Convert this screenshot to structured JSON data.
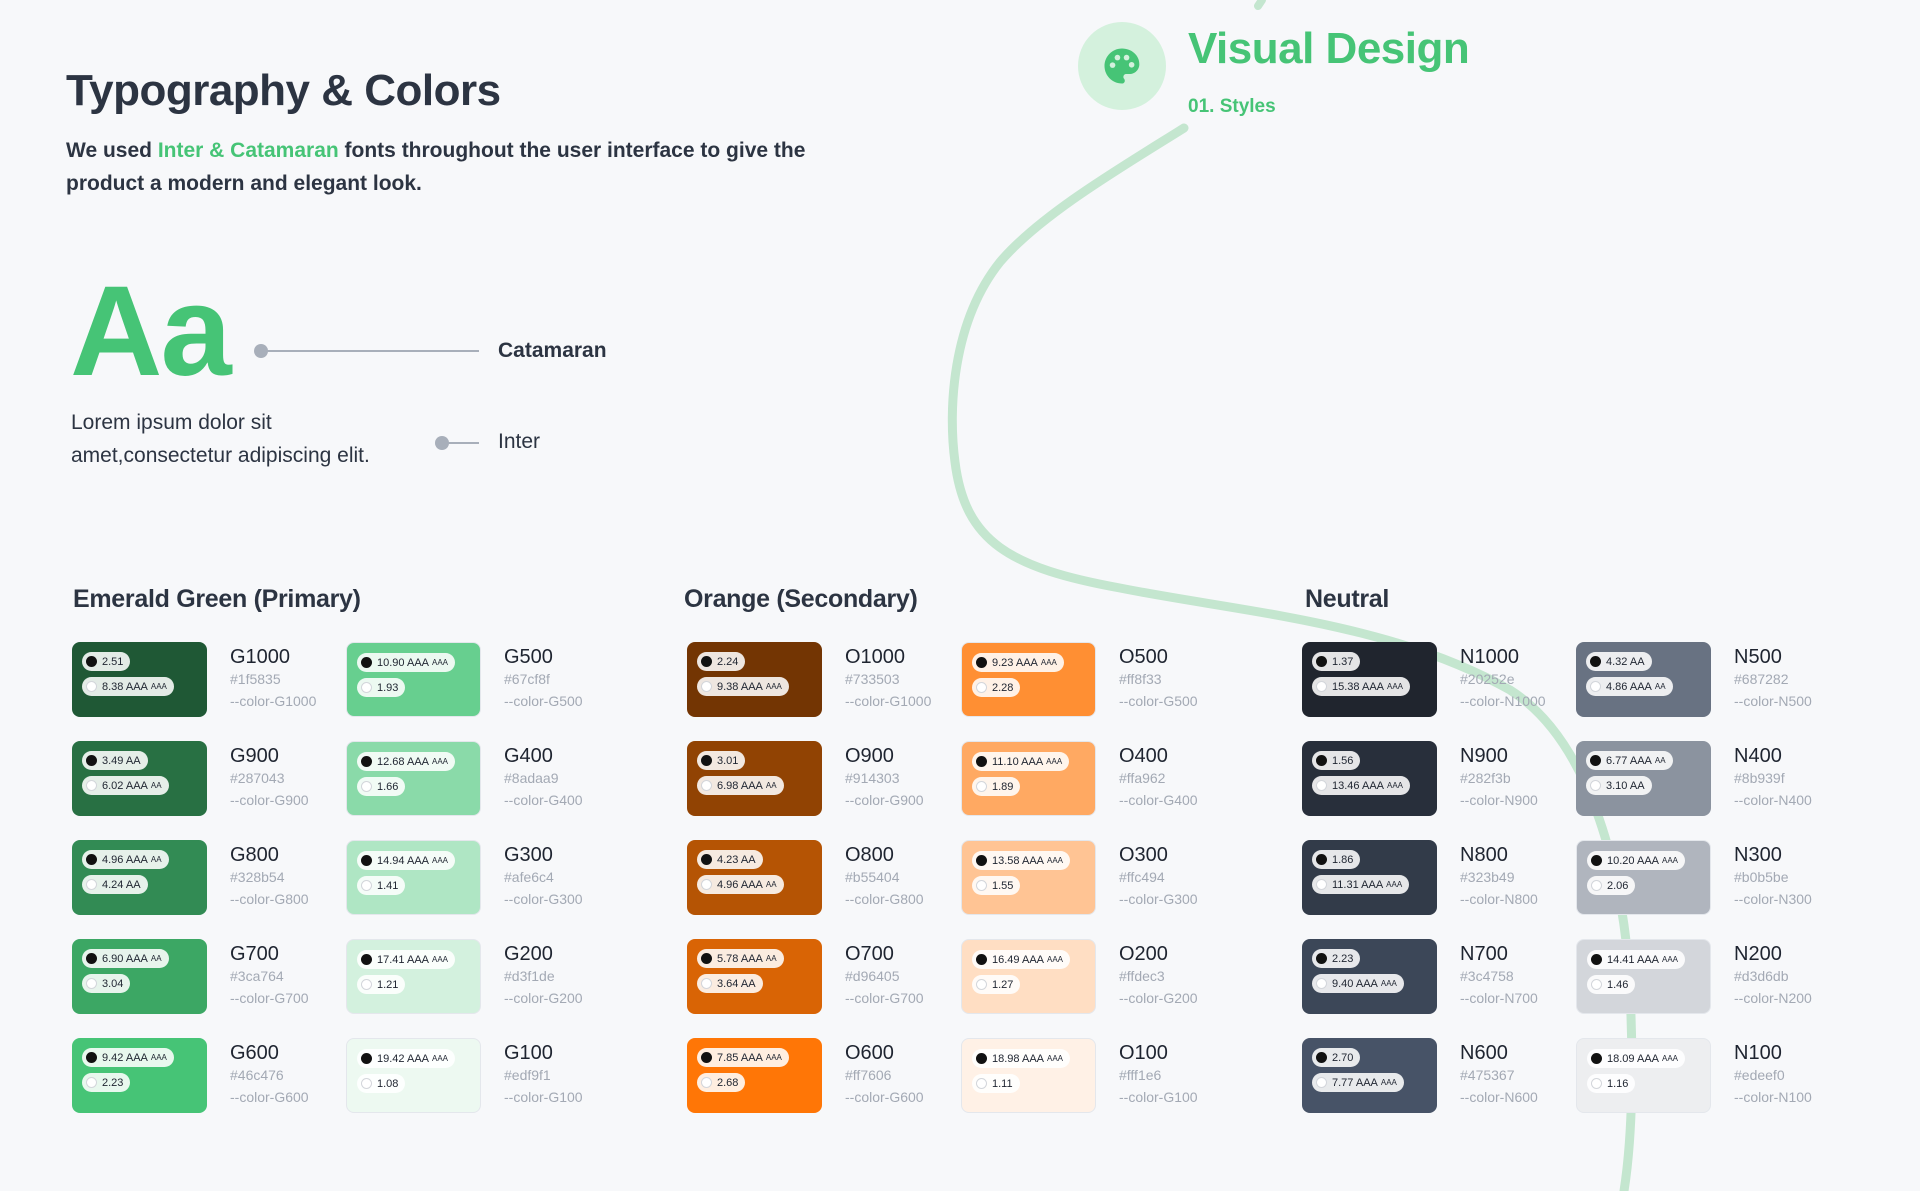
{
  "section": {
    "title": "Visual Design",
    "subtitle": "01. Styles",
    "icon": "palette-icon",
    "icon_bg": "#d4f1dd",
    "accent": "#46c476"
  },
  "typography": {
    "title": "Typography & Colors",
    "intro_prefix": "We used ",
    "intro_accent": "Inter & Catamaran",
    "intro_suffix": " fonts throughout the user interface to give the product a modern and elegant look.",
    "aa_sample": "Aa",
    "body_sample": "Lorem ipsum dolor sit amet,consectetur adipiscing elit.",
    "heading_font_label": "Catamaran",
    "body_font_label": "Inter"
  },
  "palettes": [
    {
      "title": "Emerald Green (Primary)",
      "colors": [
        {
          "code": "G1000",
          "hex": "#1f5835",
          "var": "--color-G1000",
          "dark": true,
          "black": "2.51",
          "white": "8.38 AAA",
          "white_badge": "AAA"
        },
        {
          "code": "G500",
          "hex": "#67cf8f",
          "var": "--color-G500",
          "dark": false,
          "black": "10.90 AAA",
          "black_badge": "AAA",
          "white": "1.93"
        },
        {
          "code": "G900",
          "hex": "#287043",
          "var": "--color-G900",
          "dark": true,
          "black": "3.49 AA",
          "white": "6.02 AAA",
          "white_badge": "AA"
        },
        {
          "code": "G400",
          "hex": "#8adaa9",
          "var": "--color-G400",
          "dark": false,
          "black": "12.68 AAA",
          "black_badge": "AAA",
          "white": "1.66"
        },
        {
          "code": "G800",
          "hex": "#328b54",
          "var": "--color-G800",
          "dark": true,
          "black": "4.96 AAA",
          "black_badge": "AA",
          "white": "4.24 AA"
        },
        {
          "code": "G300",
          "hex": "#afe6c4",
          "var": "--color-G300",
          "dark": false,
          "black": "14.94 AAA",
          "black_badge": "AAA",
          "white": "1.41"
        },
        {
          "code": "G700",
          "hex": "#3ca764",
          "var": "--color-G700",
          "dark": true,
          "black": "6.90 AAA",
          "black_badge": "AA",
          "white": "3.04"
        },
        {
          "code": "G200",
          "hex": "#d3f1de",
          "var": "--color-G200",
          "dark": false,
          "black": "17.41 AAA",
          "black_badge": "AAA",
          "white": "1.21"
        },
        {
          "code": "G600",
          "hex": "#46c476",
          "var": "--color-G600",
          "dark": true,
          "black": "9.42 AAA",
          "black_badge": "AAA",
          "white": "2.23"
        },
        {
          "code": "G100",
          "hex": "#edf9f1",
          "var": "--color-G100",
          "dark": false,
          "black": "19.42 AAA",
          "black_badge": "AAA",
          "white": "1.08"
        }
      ]
    },
    {
      "title": "Orange (Secondary)",
      "colors": [
        {
          "code": "O1000",
          "hex": "#733503",
          "var": "--color-G1000",
          "dark": true,
          "black": "2.24",
          "white": "9.38 AAA",
          "white_badge": "AAA"
        },
        {
          "code": "O500",
          "hex": "#ff8f33",
          "var": "--color-G500",
          "dark": false,
          "black": "9.23 AAA",
          "black_badge": "AAA",
          "white": "2.28"
        },
        {
          "code": "O900",
          "hex": "#914303",
          "var": "--color-G900",
          "dark": true,
          "black": "3.01",
          "white": "6.98 AAA",
          "white_badge": "AA"
        },
        {
          "code": "O400",
          "hex": "#ffa962",
          "var": "--color-G400",
          "dark": false,
          "black": "11.10 AAA",
          "black_badge": "AAA",
          "white": "1.89"
        },
        {
          "code": "O800",
          "hex": "#b55404",
          "var": "--color-G800",
          "dark": true,
          "black": "4.23 AA",
          "white": "4.96 AAA",
          "white_badge": "AA"
        },
        {
          "code": "O300",
          "hex": "#ffc494",
          "var": "--color-G300",
          "dark": false,
          "black": "13.58 AAA",
          "black_badge": "AAA",
          "white": "1.55"
        },
        {
          "code": "O700",
          "hex": "#d96405",
          "var": "--color-G700",
          "dark": true,
          "black": "5.78 AAA",
          "black_badge": "AA",
          "white": "3.64 AA"
        },
        {
          "code": "O200",
          "hex": "#ffdec3",
          "var": "--color-G200",
          "dark": false,
          "black": "16.49 AAA",
          "black_badge": "AAA",
          "white": "1.27"
        },
        {
          "code": "O600",
          "hex": "#ff7606",
          "var": "--color-G600",
          "dark": true,
          "black": "7.85 AAA",
          "black_badge": "AAA",
          "white": "2.68"
        },
        {
          "code": "O100",
          "hex": "#fff1e6",
          "var": "--color-G100",
          "dark": false,
          "black": "18.98 AAA",
          "black_badge": "AAA",
          "white": "1.11"
        }
      ]
    },
    {
      "title": "Neutral",
      "colors": [
        {
          "code": "N1000",
          "hex": "#20252e",
          "var": "--color-N1000",
          "dark": true,
          "black": "1.37",
          "white": "15.38 AAA",
          "white_badge": "AAA"
        },
        {
          "code": "N500",
          "hex": "#687282",
          "var": "--color-N500",
          "dark": true,
          "black": "4.32 AA",
          "white": "4.86 AAA",
          "white_badge": "AA"
        },
        {
          "code": "N900",
          "hex": "#282f3b",
          "var": "--color-N900",
          "dark": true,
          "black": "1.56",
          "white": "13.46 AAA",
          "white_badge": "AAA"
        },
        {
          "code": "N400",
          "hex": "#8b939f",
          "var": "--color-N400",
          "dark": true,
          "black": "6.77 AAA",
          "black_badge": "AA",
          "white": "3.10 AA"
        },
        {
          "code": "N800",
          "hex": "#323b49",
          "var": "--color-N800",
          "dark": true,
          "black": "1.86",
          "white": "11.31 AAA",
          "white_badge": "AAA"
        },
        {
          "code": "N300",
          "hex": "#b0b5be",
          "var": "--color-N300",
          "dark": false,
          "black": "10.20 AAA",
          "black_badge": "AAA",
          "white": "2.06"
        },
        {
          "code": "N700",
          "hex": "#3c4758",
          "var": "--color-N700",
          "dark": true,
          "black": "2.23",
          "white": "9.40 AAA",
          "white_badge": "AAA"
        },
        {
          "code": "N200",
          "hex": "#d3d6db",
          "var": "--color-N200",
          "dark": false,
          "black": "14.41 AAA",
          "black_badge": "AAA",
          "white": "1.46"
        },
        {
          "code": "N600",
          "hex": "#475367",
          "var": "--color-N600",
          "dark": true,
          "black": "2.70",
          "white": "7.77 AAA",
          "white_badge": "AAA"
        },
        {
          "code": "N100",
          "hex": "#edeef0",
          "var": "--color-N100",
          "dark": false,
          "black": "18.09 AAA",
          "black_badge": "AAA",
          "white": "1.16"
        }
      ]
    }
  ]
}
